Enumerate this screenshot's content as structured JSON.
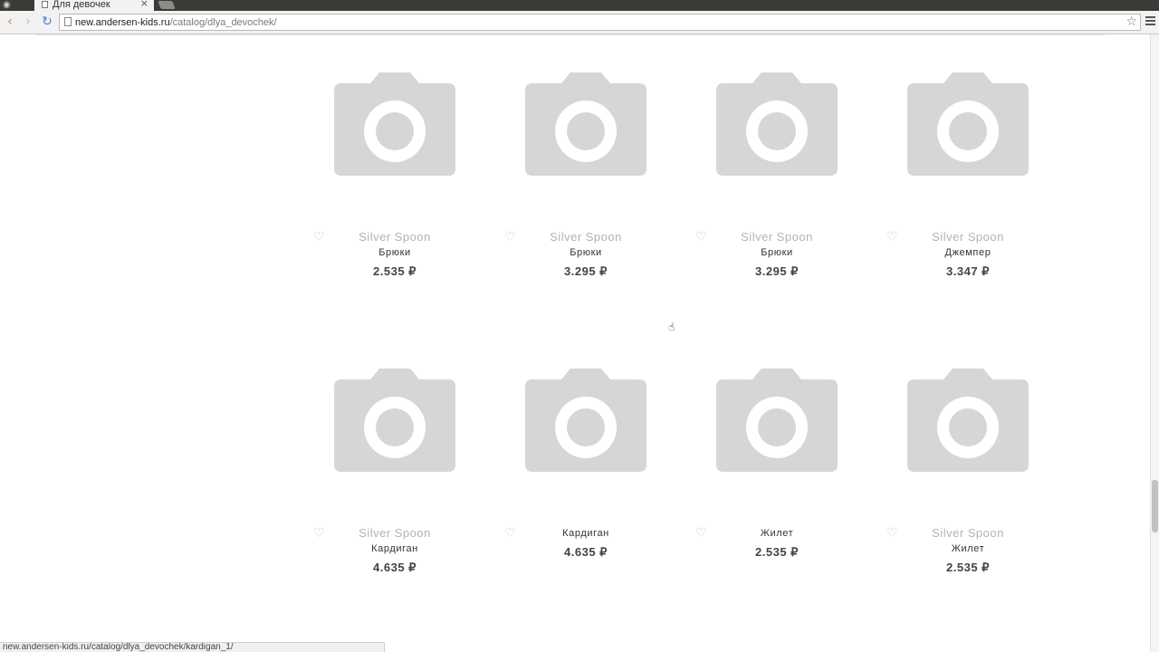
{
  "browser": {
    "tab_title": "Для девочек",
    "tab_close": "×",
    "url_host": "new.andersen-kids.ru",
    "url_path": "/catalog/dlya_devochek/",
    "back_icon": "‹",
    "forward_icon": "›",
    "reload_icon": "↻",
    "star_icon": "☆"
  },
  "status": {
    "hover_url": "new.andersen-kids.ru/catalog/dlya_devochek/kardigan_1/"
  },
  "products": [
    {
      "brand": "Silver Spoon",
      "name": "Брюки",
      "price": "2.535 ₽"
    },
    {
      "brand": "Silver Spoon",
      "name": "Брюки",
      "price": "3.295 ₽"
    },
    {
      "brand": "Silver Spoon",
      "name": "Брюки",
      "price": "3.295 ₽"
    },
    {
      "brand": "Silver Spoon",
      "name": "Джемпер",
      "price": "3.347 ₽"
    },
    {
      "brand": "Silver Spoon",
      "name": "Кардиган",
      "price": "4.635 ₽"
    },
    {
      "brand": "",
      "name": "Кардиган",
      "price": "4.635 ₽"
    },
    {
      "brand": "",
      "name": "Жилет",
      "price": "2.535 ₽"
    },
    {
      "brand": "Silver Spoon",
      "name": "Жилет",
      "price": "2.535 ₽"
    }
  ],
  "icons": {
    "favorite": "heart-icon",
    "placeholder": "camera-placeholder-icon",
    "cursor": "hand-pointer-icon"
  },
  "colors": {
    "placeholder_gray": "#d6d6d6",
    "brand_gray": "#b3b3b3",
    "price": "#444444"
  }
}
